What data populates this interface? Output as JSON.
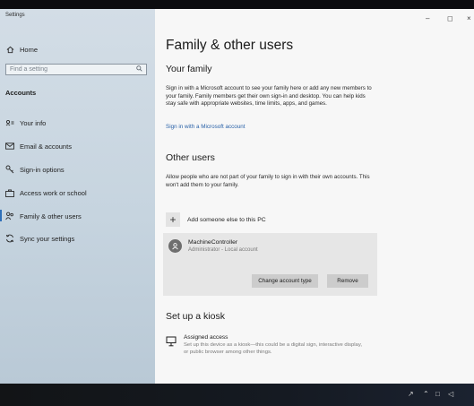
{
  "window": {
    "app_title": "Settings",
    "controls": {
      "minimize": "–",
      "maximize": "◻",
      "close": "×"
    }
  },
  "sidebar": {
    "home_label": "Home",
    "search_placeholder": "Find a setting",
    "section_title": "Accounts",
    "items": [
      {
        "label": "Your info",
        "icon": "person-card-icon"
      },
      {
        "label": "Email & accounts",
        "icon": "email-icon"
      },
      {
        "label": "Sign-in options",
        "icon": "key-icon"
      },
      {
        "label": "Access work or school",
        "icon": "briefcase-icon"
      },
      {
        "label": "Family & other users",
        "icon": "people-icon",
        "selected": true
      },
      {
        "label": "Sync your settings",
        "icon": "sync-icon"
      }
    ]
  },
  "main": {
    "page_title": "Family & other users",
    "your_family": {
      "heading": "Your family",
      "description": "Sign in with a Microsoft account to see your family here or add any new members to your family. Family members get their own sign-in and desktop. You can help kids stay safe with appropriate websites, time limits, apps, and games.",
      "link": "Sign in with a Microsoft account"
    },
    "other_users": {
      "heading": "Other users",
      "description": "Allow people who are not part of your family to sign in with their own accounts. This won't add them to your family.",
      "add_label": "Add someone else to this PC",
      "user": {
        "name": "MachineController",
        "meta": "Administrator - Local account",
        "change_button": "Change account type",
        "remove_button": "Remove"
      }
    },
    "kiosk": {
      "heading": "Set up a kiosk",
      "title": "Assigned access",
      "description": "Set up this device as a kiosk—this could be a digital sign, interactive display, or public browser among other things."
    }
  },
  "colors": {
    "accent": "#2e6fb8",
    "link": "#2a62a8",
    "sidebar_bg": "#c6d4df",
    "card_bg": "#e6e6e6"
  }
}
